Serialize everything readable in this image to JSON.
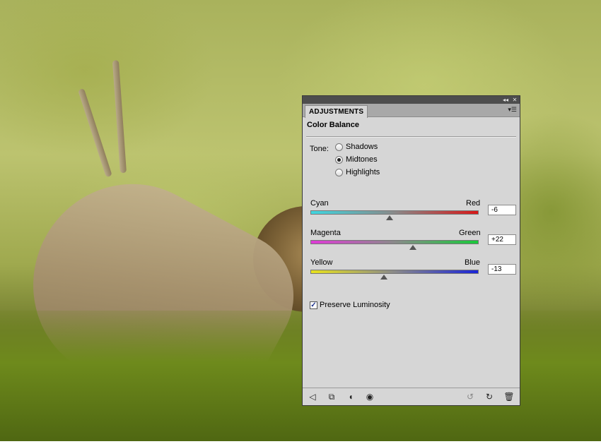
{
  "panel": {
    "tab_label": "ADJUSTMENTS",
    "title": "Color Balance",
    "tone_label": "Tone:",
    "tones": [
      {
        "label": "Shadows",
        "selected": false
      },
      {
        "label": "Midtones",
        "selected": true
      },
      {
        "label": "Highlights",
        "selected": false
      }
    ],
    "sliders": [
      {
        "left_label": "Cyan",
        "right_label": "Red",
        "value": "-6",
        "numeric": -6,
        "gradient": [
          "#3fd6e0",
          "#d81818"
        ]
      },
      {
        "left_label": "Magenta",
        "right_label": "Green",
        "value": "+22",
        "numeric": 22,
        "gradient": [
          "#e03ad8",
          "#18c93a"
        ]
      },
      {
        "left_label": "Yellow",
        "right_label": "Blue",
        "value": "-13",
        "numeric": -13,
        "gradient": [
          "#e8e21c",
          "#1a24d8"
        ]
      }
    ],
    "preserve_luminosity": {
      "label": "Preserve Luminosity",
      "checked": true
    },
    "footer_icons": [
      "back-arrow-icon",
      "clip-to-layer-icon",
      "layer-visibility-mask-icon",
      "eye-icon",
      "previous-state-icon",
      "reset-icon",
      "trash-icon"
    ]
  },
  "colors": {
    "panel_bg": "#d6d6d6",
    "titlebar": "#4d4d4d",
    "tabbar": "#a8a8a8"
  }
}
